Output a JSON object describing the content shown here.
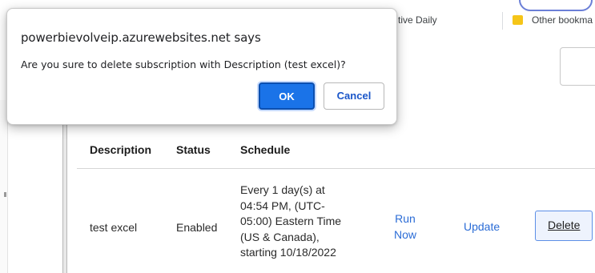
{
  "bookmarks": {
    "items": [
      {
        "label": "tive Daily"
      },
      {
        "label": "Other bookma"
      }
    ]
  },
  "dialog": {
    "title": "powerbievolveip.azurewebsites.net says",
    "message": "Are you sure to delete subscription with Description (test excel)?",
    "ok_label": "OK",
    "cancel_label": "Cancel"
  },
  "table": {
    "columns": [
      "Description",
      "Status",
      "Schedule"
    ],
    "rows": [
      {
        "description": "test excel",
        "status": "Enabled",
        "schedule_lines": [
          "Every 1 day(s) at",
          "04:54 PM, (UTC-",
          "05:00) Eastern Time",
          "(US & Canada),",
          "starting 10/18/2022"
        ],
        "run_now_lines": [
          "Run",
          "Now"
        ],
        "update_label": "Update",
        "delete_label": "Delete"
      }
    ]
  },
  "colors": {
    "accent": "#1a73e8",
    "link": "#2b6cd6",
    "folder": "#f5c518"
  }
}
